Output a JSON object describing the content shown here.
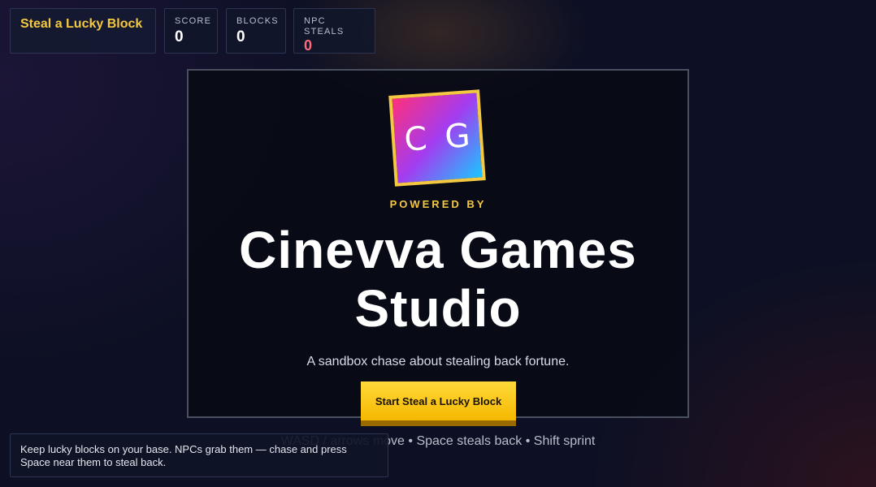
{
  "hud": {
    "title": "Steal a Lucky Block",
    "stats": [
      {
        "label": "SCORE",
        "value": "0"
      },
      {
        "label": "BLOCKS",
        "value": "0"
      },
      {
        "label": "NPC STEALS",
        "value": "0"
      }
    ]
  },
  "splash": {
    "logo_letters": [
      "C",
      "G"
    ],
    "powered_by": "POWERED BY",
    "studio_name": "Cinevva Games Studio",
    "tagline": "A sandbox chase about stealing back fortune.",
    "start_button": "Start Steal a Lucky Block",
    "controls": "WASD / arrows move • Space steals back • Shift sprint"
  },
  "tip": "Keep lucky blocks on your base. NPCs grab them — chase and press Space near them to steal back.",
  "colors": {
    "accent": "#f5c842",
    "danger": "#ff6b7d",
    "background": "#0d1024"
  }
}
